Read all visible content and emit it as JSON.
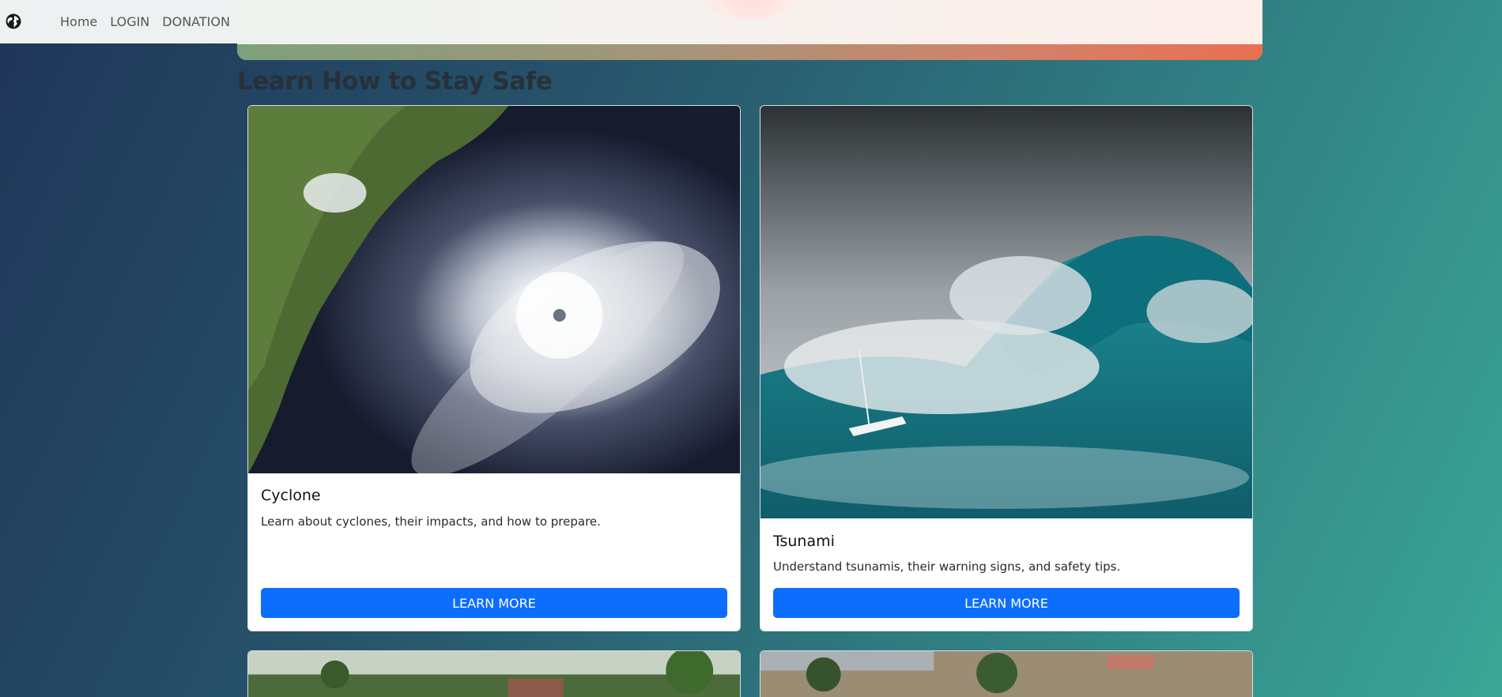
{
  "nav": {
    "links": [
      "Home",
      "LOGIN",
      "DONATION"
    ]
  },
  "section": {
    "title": "Learn How to Stay Safe"
  },
  "cards": [
    {
      "title": "Cyclone",
      "text": "Learn about cyclones, their impacts, and how to prepare.",
      "button": "LEARN MORE"
    },
    {
      "title": "Tsunami",
      "text": "Understand tsunamis, their warning signs, and safety tips.",
      "button": "LEARN MORE"
    }
  ],
  "colors": {
    "button": "#0d6efd",
    "heading": "#26313a"
  }
}
